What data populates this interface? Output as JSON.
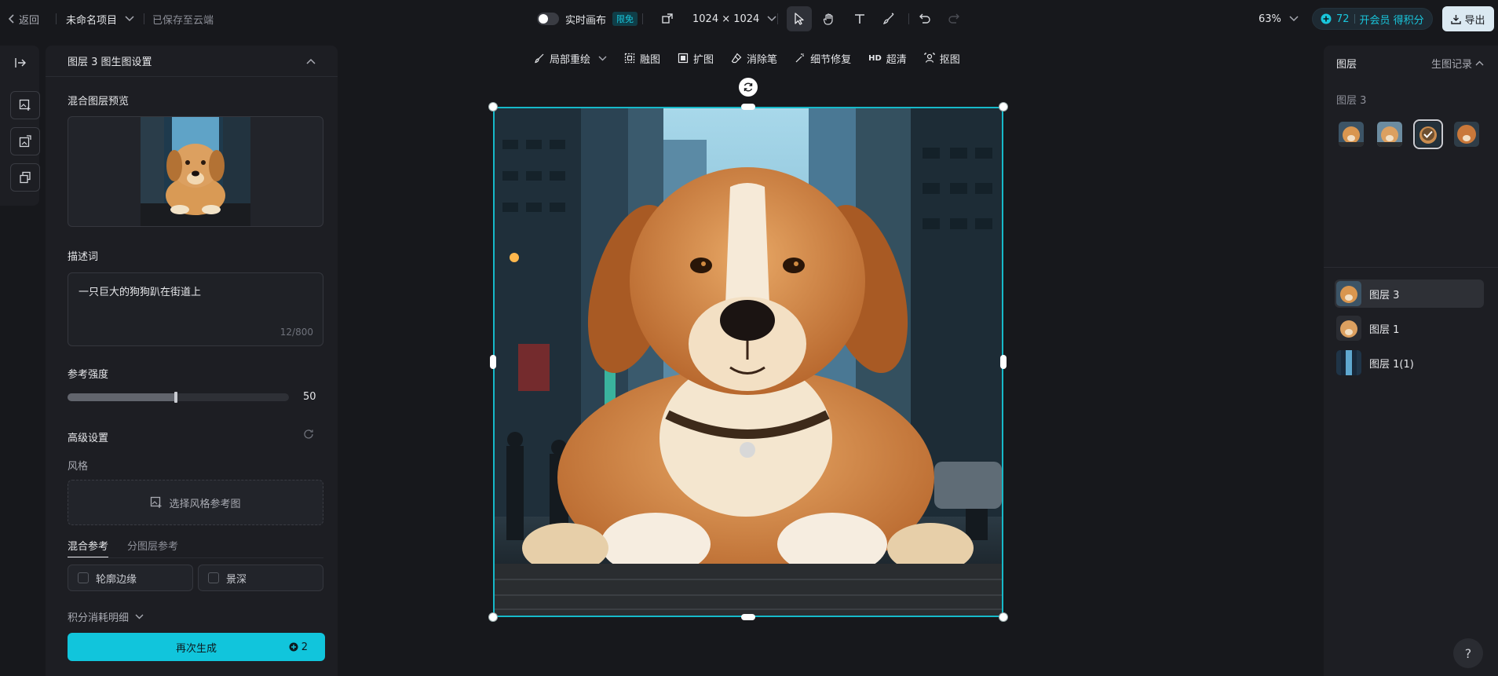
{
  "topbar": {
    "back_label": "返回",
    "project_name": "未命名项目",
    "saved_status": "已保存至云端",
    "realtime_label": "实时画布",
    "realtime_badge": "限免",
    "canvas_size": "1024 × 1024",
    "zoom": "63%",
    "credits": "72",
    "member_label": "开会员 得积分",
    "export_label": "导出",
    "icons": [
      "chevron-left-icon",
      "chevron-down-icon",
      "resize-icon",
      "cursor-icon",
      "hand-icon",
      "text-icon",
      "brush-icon",
      "undo-icon",
      "redo-icon",
      "plus-circle-icon",
      "download-icon"
    ]
  },
  "left_rail": {
    "icons": [
      "collapse-icon",
      "add-image-icon",
      "image-edit-icon",
      "layers-icon"
    ]
  },
  "settings": {
    "title": "图层 3 图生图设置",
    "preview_label": "混合图层预览",
    "prompt_label": "描述词",
    "prompt_text": "一只巨大的狗狗趴在街道上",
    "prompt_count": "12/800",
    "strength_label": "参考强度",
    "strength_value": "50",
    "strength_fraction": 0.5,
    "advanced_label": "高级设置",
    "style_label": "风格",
    "style_button": "选择风格参考图",
    "tabs": [
      "混合参考",
      "分图层参考"
    ],
    "options": [
      "轮廓边缘",
      "景深"
    ],
    "credits_detail": "积分消耗明细",
    "regenerate_label": "再次生成",
    "regenerate_cost": "2"
  },
  "subtools": {
    "items": [
      "局部重绘",
      "融图",
      "扩图",
      "消除笔",
      "细节修复",
      "超清",
      "抠图"
    ],
    "hd_badge": "HD"
  },
  "right_panel": {
    "title": "图层",
    "history_label": "生图记录",
    "section_label": "图层 3",
    "layers": [
      "图层 3",
      "图层 1",
      "图层 1(1)"
    ]
  },
  "help_label": "?"
}
